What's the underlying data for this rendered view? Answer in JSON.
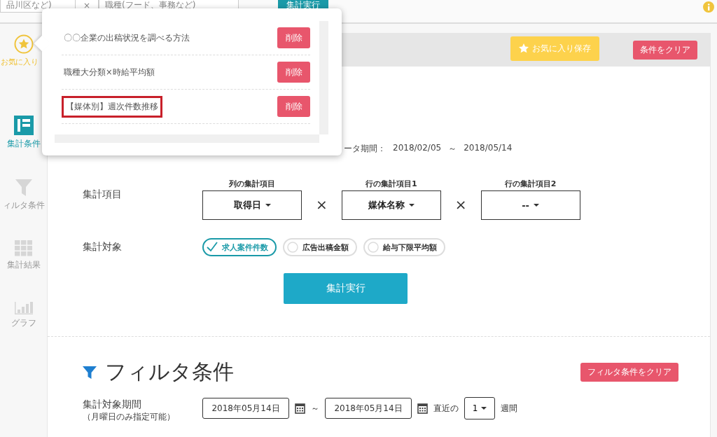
{
  "top_bar": {
    "area_field": "品川区など)",
    "clear_icon": "×",
    "job_field": "職種(フード、事務など)",
    "search_button": "集計実行"
  },
  "sidebar": {
    "items": [
      {
        "label": "お気に入り",
        "kind": "star",
        "color": "#f0c43c"
      },
      {
        "label": "集計条件",
        "kind": "form",
        "color": "#1a9aa8"
      },
      {
        "label": "ィルタ条件",
        "kind": "filter",
        "color": "#d6d6d6"
      },
      {
        "label": "集計結果",
        "kind": "grid",
        "color": "#d6d6d6"
      },
      {
        "label": "グラフ",
        "kind": "bars",
        "color": "#d6d6d6"
      }
    ]
  },
  "favorites_popover": {
    "items": [
      {
        "label": "〇〇企業の出稿状況を調べる方法",
        "highlighted": false,
        "delete_button": "削除"
      },
      {
        "label": "職種大分類×時給平均額",
        "highlighted": false,
        "delete_button": "削除"
      },
      {
        "label": "【媒体別】週次件数推移",
        "highlighted": true,
        "delete_button": "削除"
      }
    ]
  },
  "header": {
    "save_favorite_button": "お気に入り保存",
    "clear_button": "条件をクリア"
  },
  "data_period": {
    "label": "ータ期間：",
    "from": "2018/02/05",
    "separator": "～",
    "to": "2018/05/14"
  },
  "aggregation_items": {
    "label": "集計項目",
    "separator": "×",
    "selects": [
      {
        "header": "列の集計項目",
        "value": "取得日"
      },
      {
        "header": "行の集計項目1",
        "value": "媒体名称"
      },
      {
        "header": "行の集計項目2",
        "value": "--"
      }
    ]
  },
  "aggregation_target": {
    "label": "集計対象",
    "options": [
      {
        "label": "求人案件件数",
        "selected": true
      },
      {
        "label": "広告出稿金額",
        "selected": false
      },
      {
        "label": "給与下限平均額",
        "selected": false
      }
    ]
  },
  "execute_button": "集計実行",
  "filter": {
    "title": "フィルタ条件",
    "clear_button": "フィルタ条件をクリア",
    "period_label": "集計対象期間",
    "period_note": "（月曜日のみ指定可能）",
    "from": "2018年05月14日",
    "tilde": "～",
    "to": "2018年05月14日",
    "recent_label": "直近の",
    "weeks": "1",
    "weeks_unit": "週間"
  }
}
